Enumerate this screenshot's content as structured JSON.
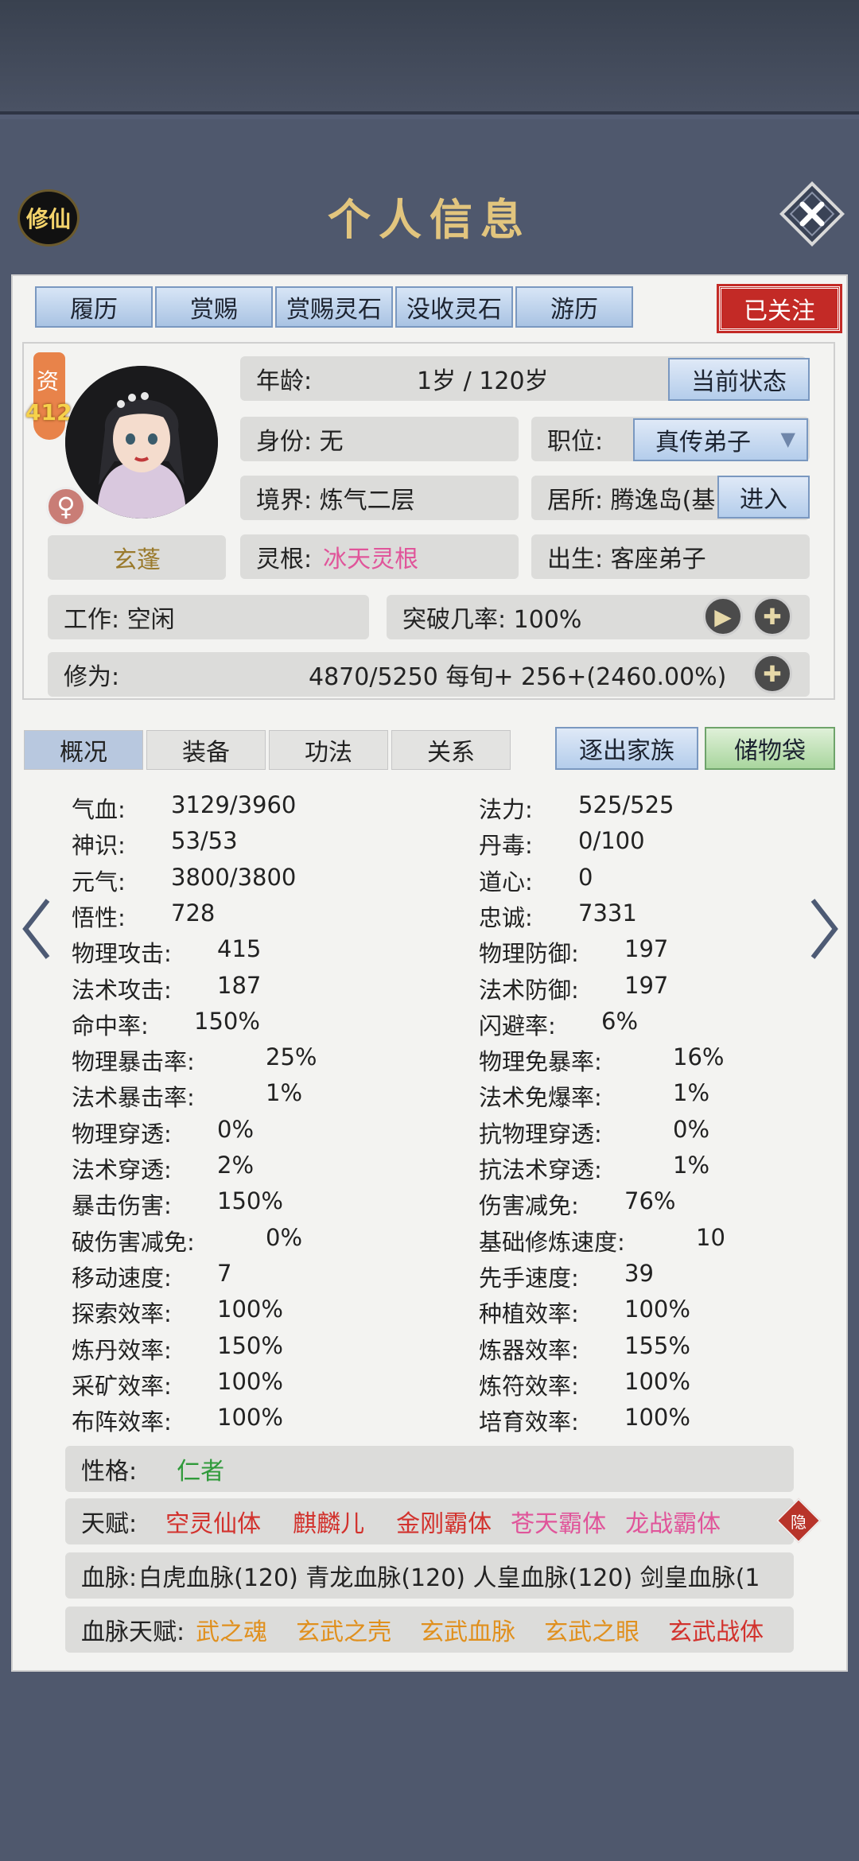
{
  "header": {
    "badge": "修仙",
    "title": "个人信息"
  },
  "top_tabs": [
    "履历",
    "赏赐",
    "赏赐灵石",
    "没收灵石",
    "游历"
  ],
  "follow_button": "已关注",
  "profile": {
    "zi_label": "资",
    "zi_value": "412",
    "gender_icon": "♀",
    "name": "玄蓬",
    "age_label": "年龄:",
    "age_value": "1岁 / 120岁",
    "status_button": "当前状态",
    "identity": "身份:  无",
    "position_label": "职位:",
    "position_value": "真传弟子",
    "realm": "境界:  炼气二层",
    "residence": "居所: 腾逸岛(基",
    "enter_button": "进入",
    "root_label": "灵根:",
    "root_value": "冰天灵根",
    "birth": "出生:  客座弟子",
    "work": "工作: 空闲",
    "breakthrough": "突破几率:  100%",
    "cultivation_label": "修为:",
    "cultivation_value": "4870/5250  每旬+  256+(2460.00%)"
  },
  "bottom_tabs": [
    "概况",
    "装备",
    "功法",
    "关系"
  ],
  "expel_button": "逐出家族",
  "storage_button": "储物袋",
  "stats_left": [
    {
      "label": "气血:",
      "value": "3129/3960"
    },
    {
      "label": "神识:",
      "value": "53/53"
    },
    {
      "label": "元气:",
      "value": "3800/3800"
    },
    {
      "label": "悟性:",
      "value": "728"
    },
    {
      "label": "物理攻击:",
      "value": "415"
    },
    {
      "label": "法术攻击:",
      "value": "187"
    },
    {
      "label": "命中率:",
      "value": "150%"
    },
    {
      "label": "物理暴击率:",
      "value": "25%"
    },
    {
      "label": "法术暴击率:",
      "value": "1%"
    },
    {
      "label": "物理穿透:",
      "value": "0%"
    },
    {
      "label": "法术穿透:",
      "value": "2%"
    },
    {
      "label": "暴击伤害:",
      "value": "150%"
    },
    {
      "label": "破伤害减免:",
      "value": "0%"
    },
    {
      "label": "移动速度:",
      "value": "7"
    },
    {
      "label": "探索效率:",
      "value": "100%"
    },
    {
      "label": "炼丹效率:",
      "value": "150%"
    },
    {
      "label": "采矿效率:",
      "value": "100%"
    },
    {
      "label": "布阵效率:",
      "value": "100%"
    }
  ],
  "stats_right": [
    {
      "label": "法力:",
      "value": "525/525"
    },
    {
      "label": "丹毒:",
      "value": "0/100"
    },
    {
      "label": "道心:",
      "value": "0"
    },
    {
      "label": "忠诚:",
      "value": "7331"
    },
    {
      "label": "物理防御:",
      "value": "197"
    },
    {
      "label": "法术防御:",
      "value": "197"
    },
    {
      "label": "闪避率:",
      "value": "6%"
    },
    {
      "label": "物理免暴率:",
      "value": "16%"
    },
    {
      "label": "法术免爆率:",
      "value": "1%"
    },
    {
      "label": "抗物理穿透:",
      "value": "0%"
    },
    {
      "label": "抗法术穿透:",
      "value": "1%"
    },
    {
      "label": "伤害减免:",
      "value": "76%"
    },
    {
      "label": "基础修炼速度:",
      "value": "10"
    },
    {
      "label": "先手速度:",
      "value": "39"
    },
    {
      "label": "种植效率:",
      "value": "100%"
    },
    {
      "label": "炼器效率:",
      "value": "155%"
    },
    {
      "label": "炼符效率:",
      "value": "100%"
    },
    {
      "label": "培育效率:",
      "value": "100%"
    }
  ],
  "personality": {
    "label": "性格:",
    "value": "仁者"
  },
  "talents": {
    "label": "天赋:",
    "items": [
      "空灵仙体",
      "麒麟儿",
      "金刚霸体",
      "苍天霸体",
      "龙战霸体"
    ],
    "hide_badge": "隐"
  },
  "bloodline": {
    "label": "血脉:",
    "value": "白虎血脉(120) 青龙血脉(120) 人皇血脉(120) 剑皇血脉(1"
  },
  "bloodline_talents": {
    "label": "血脉天赋:",
    "items": [
      "武之魂",
      "玄武之壳",
      "玄武血脉",
      "玄武之眼",
      "玄武战体"
    ]
  },
  "colors": {
    "root": "#e0559a",
    "personality": "#2f9a3a",
    "talent_red": "#d2322d",
    "talent_pink": "#e0559a",
    "bloodline_orange": "#e0901e",
    "bloodline_red": "#d2322d",
    "follow": "#c32a26"
  }
}
